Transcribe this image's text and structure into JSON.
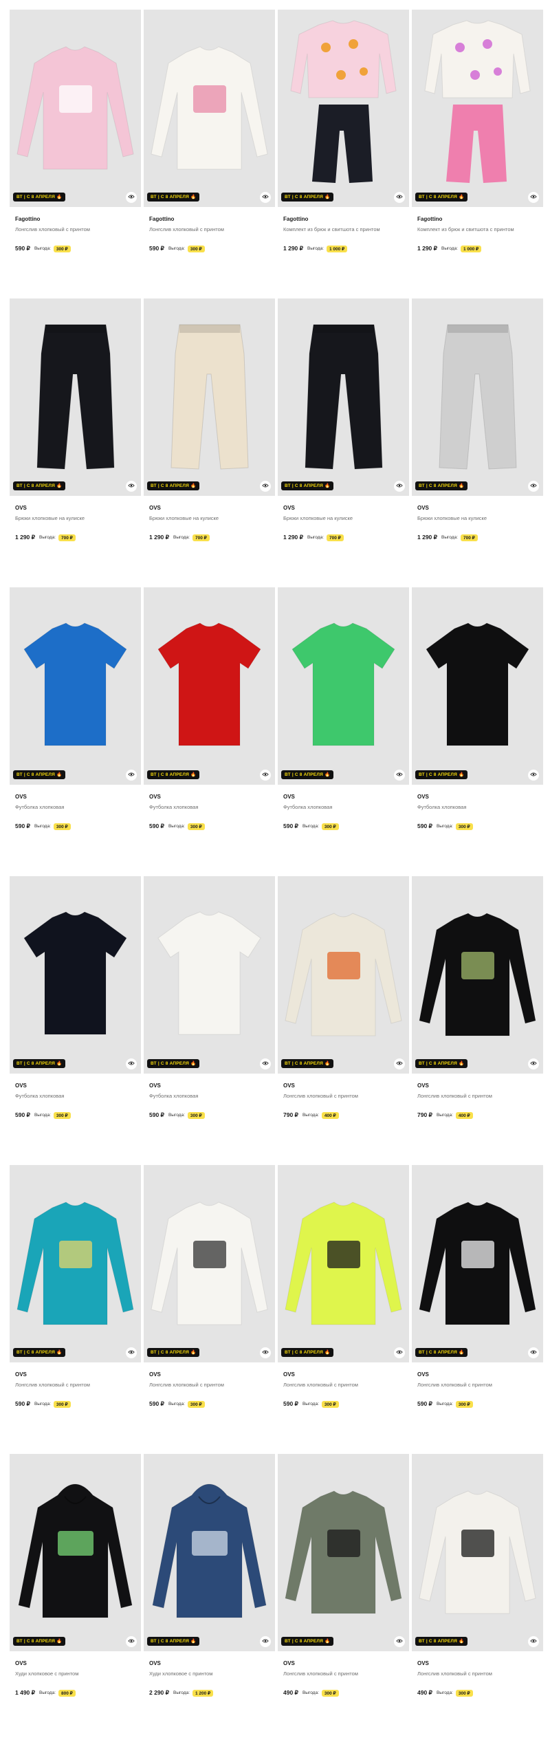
{
  "promo_label": "ВТ | С 8 АПРЕЛЯ 🔥",
  "benefit_label": "Выгода:",
  "products": [
    {
      "brand": "Fagottino",
      "name": "Лонгслив хлопковый с принтом",
      "price": "590 ₽",
      "benefit": "300 ₽",
      "icon": "pink-bear-longsleeve"
    },
    {
      "brand": "Fagottino",
      "name": "Лонгслив хлопковый с принтом",
      "price": "590 ₽",
      "benefit": "300 ₽",
      "icon": "white-hearts-longsleeve"
    },
    {
      "brand": "Fagottino",
      "name": "Комплект из брюк и свитшота с принтом",
      "price": "1 290 ₽",
      "benefit": "1 000 ₽",
      "icon": "pink-set-black-pants"
    },
    {
      "brand": "Fagottino",
      "name": "Комплект из брюк и свитшота с принтом",
      "price": "1 290 ₽",
      "benefit": "1 000 ₽",
      "icon": "white-set-pink-pants"
    },
    {
      "brand": "OVS",
      "name": "Брюки хлопковые на кулиске",
      "price": "1 290 ₽",
      "benefit": "700 ₽",
      "icon": "black-joggers"
    },
    {
      "brand": "OVS",
      "name": "Брюки хлопковые на кулиске",
      "price": "1 290 ₽",
      "benefit": "700 ₽",
      "icon": "beige-joggers"
    },
    {
      "brand": "OVS",
      "name": "Брюки хлопковые на кулиске",
      "price": "1 290 ₽",
      "benefit": "700 ₽",
      "icon": "black-joggers"
    },
    {
      "brand": "OVS",
      "name": "Брюки хлопковые на кулиске",
      "price": "1 290 ₽",
      "benefit": "700 ₽",
      "icon": "grey-joggers"
    },
    {
      "brand": "OVS",
      "name": "Футболка хлопковая",
      "price": "590 ₽",
      "benefit": "300 ₽",
      "icon": "blue-tshirt"
    },
    {
      "brand": "OVS",
      "name": "Футболка хлопковая",
      "price": "590 ₽",
      "benefit": "300 ₽",
      "icon": "red-tshirt"
    },
    {
      "brand": "OVS",
      "name": "Футболка хлопковая",
      "price": "590 ₽",
      "benefit": "300 ₽",
      "icon": "green-tshirt"
    },
    {
      "brand": "OVS",
      "name": "Футболка хлопковая",
      "price": "590 ₽",
      "benefit": "300 ₽",
      "icon": "black-tshirt"
    },
    {
      "brand": "OVS",
      "name": "Футболка хлопковая",
      "price": "590 ₽",
      "benefit": "300 ₽",
      "icon": "navy-tshirt"
    },
    {
      "brand": "OVS",
      "name": "Футболка хлопковая",
      "price": "590 ₽",
      "benefit": "300 ₽",
      "icon": "white-tshirt"
    },
    {
      "brand": "OVS",
      "name": "Лонгслив хлопковый с принтом",
      "price": "790 ₽",
      "benefit": "400 ₽",
      "icon": "cream-print-longsleeve"
    },
    {
      "brand": "OVS",
      "name": "Лонгслив хлопковый с принтом",
      "price": "790 ₽",
      "benefit": "400 ₽",
      "icon": "black-world-longsleeve"
    },
    {
      "brand": "OVS",
      "name": "Лонгслив хлопковый с принтом",
      "price": "590 ₽",
      "benefit": "300 ₽",
      "icon": "teal-print-longsleeve"
    },
    {
      "brand": "OVS",
      "name": "Лонгслив хлопковый с принтом",
      "price": "590 ₽",
      "benefit": "300 ₽",
      "icon": "white-print-longsleeve"
    },
    {
      "brand": "OVS",
      "name": "Лонгслив хлопковый с принтом",
      "price": "590 ₽",
      "benefit": "300 ₽",
      "icon": "lime-print-longsleeve"
    },
    {
      "brand": "OVS",
      "name": "Лонгслив хлопковый с принтом",
      "price": "590 ₽",
      "benefit": "300 ₽",
      "icon": "black-print-longsleeve"
    },
    {
      "brand": "OVS",
      "name": "Худи хлопковое с принтом",
      "price": "1 490 ₽",
      "benefit": "800 ₽",
      "icon": "black-hoodie"
    },
    {
      "brand": "OVS",
      "name": "Худи хлопковое с принтом",
      "price": "2 290 ₽",
      "benefit": "1 200 ₽",
      "icon": "blue-camo-hoodie"
    },
    {
      "brand": "OVS",
      "name": "Лонгслив хлопковый с принтом",
      "price": "490 ₽",
      "benefit": "300 ₽",
      "icon": "khaki-print-longsleeve"
    },
    {
      "brand": "OVS",
      "name": "Лонгслив хлопковый с принтом",
      "price": "490 ₽",
      "benefit": "300 ₽",
      "icon": "white-ride-longsleeve"
    }
  ]
}
